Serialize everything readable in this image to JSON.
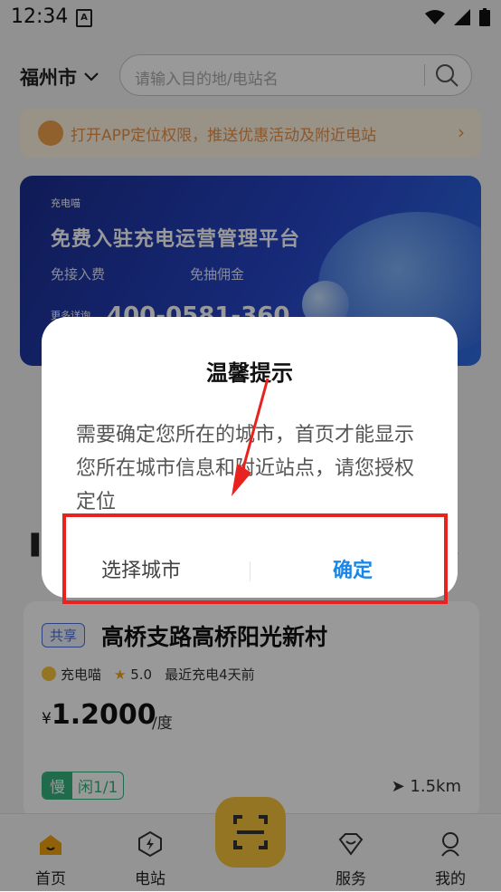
{
  "status_bar": {
    "time": "12:34",
    "notif_icon": "A"
  },
  "header": {
    "city": "福州市",
    "search_placeholder": "请输入目的地/电站名"
  },
  "location_prompt": {
    "text": "打开APP定位权限，推送优惠活动及附近电站",
    "arrow": "›"
  },
  "banner": {
    "logo": "充电喵",
    "title": "免费入驻充电运营管理平台",
    "feature1": "免接入费",
    "feature2": "免抽佣金",
    "more": "更多详询",
    "phone": "400-0581-360"
  },
  "station": {
    "tag": "共享",
    "name": "高桥支路高桥阳光新村",
    "operator": "充电喵",
    "rating": "5.0",
    "last_charge": "最近充电4天前",
    "currency": "¥",
    "price": "1.2000",
    "unit": "/度",
    "slow_label": "慢",
    "idle": "闲1/1",
    "distance": "1.5km"
  },
  "tabs": [
    {
      "label": "首页",
      "icon": "home-icon"
    },
    {
      "label": "电站",
      "icon": "charging-station-icon"
    },
    {
      "label": "服务",
      "icon": "service-icon"
    },
    {
      "label": "我的",
      "icon": "profile-icon"
    }
  ],
  "dialog": {
    "title": "温馨提示",
    "message": "需要确定您所在的城市，首页才能显示您所在城市信息和附近站点，请您授权定位",
    "choose_city": "选择城市",
    "confirm": "确定"
  },
  "colors": {
    "accent": "#1a86e8",
    "brand_yellow": "#f6c33b",
    "annotation_red": "#e8231f"
  }
}
